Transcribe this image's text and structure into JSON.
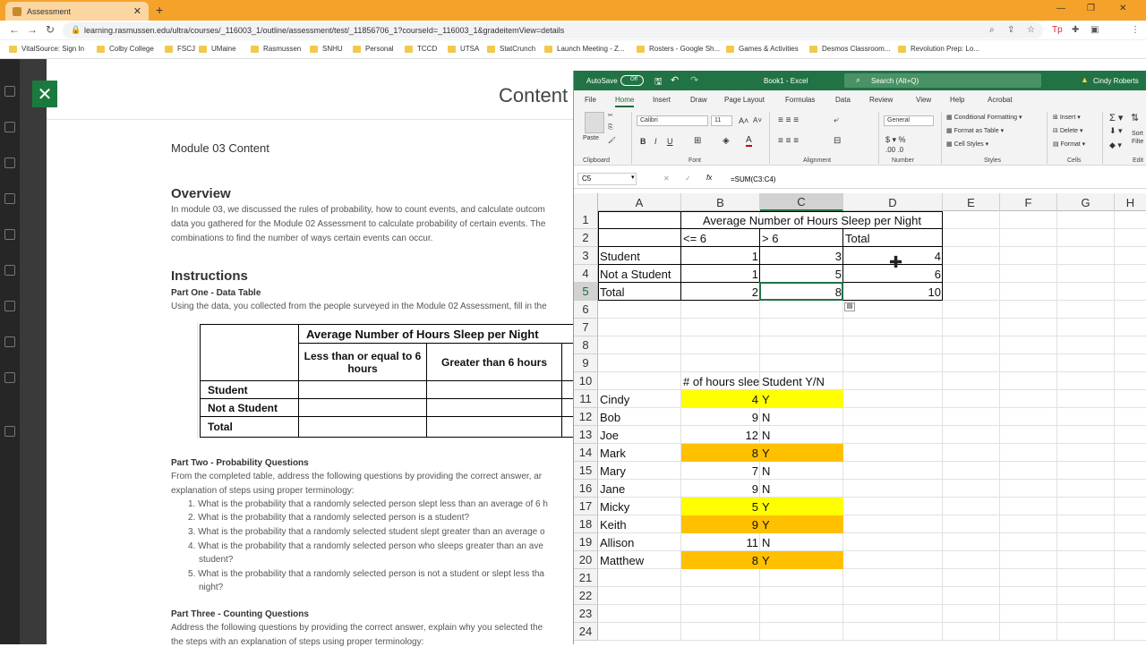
{
  "browser": {
    "tab_title": "Assessment",
    "url": "learning.rasmussen.edu/ultra/courses/_116003_1/outline/assessment/test/_11856706_1?courseId=_116003_1&gradeitemView=details",
    "bookmarks": [
      "VitalSource: Sign In",
      "Colby College",
      "FSCJ",
      "UMaine",
      "Rasmussen",
      "SNHU",
      "Personal",
      "TCCD",
      "UTSA",
      "StatCrunch",
      "Launch Meeting - Z...",
      "Rosters - Google Sh...",
      "Games & Activities",
      "Desmos Classroom...",
      "Revolution Prep: Lo..."
    ]
  },
  "lms": {
    "header_title": "Content",
    "module_title": "Module 03 Content",
    "overview_heading": "Overview",
    "overview_lines": [
      "In module 03, we discussed the rules of probability, how to count events, and calculate outcom",
      "data you gathered for the Module 02 Assessment to calculate probability of certain events. The",
      "combinations to find the number of ways certain events can occur."
    ],
    "instructions_heading": "Instructions",
    "part_one": "Part One - Data Table",
    "part_one_text": "Using the data, you collected from the people surveyed in the Module 02 Assessment, fill in the",
    "table": {
      "header": "Average Number of Hours Sleep per Night",
      "col1": "Less than or equal to 6 hours",
      "col2": "Greater than 6 hours",
      "rows": [
        "Student",
        "Not a Student",
        "Total"
      ]
    },
    "part_two": "Part Two - Probability Questions",
    "part_two_lines": [
      "From the completed table, address the following questions by providing the correct answer, ar",
      "explanation of steps using proper terminology:"
    ],
    "questions": [
      "1. What is the probability that a randomly selected person slept less than an average of 6 h",
      "2. What is the probability that a randomly selected person is a student?",
      "3. What is the probability that a randomly selected student slept greater than an average o",
      "4. What is the probability that a randomly selected person who sleeps greater than an ave",
      "student?",
      "5. What is the probability that a randomly selected person is not a student or slept less tha",
      "night?"
    ],
    "part_three": "Part Three - Counting Questions",
    "part_three_lines": [
      "Address the following questions by providing the correct answer, explain why you selected the",
      "the steps with an explanation of steps using proper terminology:"
    ]
  },
  "excel": {
    "autosave": "AutoSave",
    "toggle": "Off",
    "book": "Book1 - Excel",
    "search": "Search (Alt+Q)",
    "user": "Cindy Roberts",
    "tabs": [
      "File",
      "Home",
      "Insert",
      "Draw",
      "Page Layout",
      "Formulas",
      "Data",
      "Review",
      "View",
      "Help",
      "Acrobat"
    ],
    "ribbon": {
      "paste": "Paste",
      "clipboard": "Clipboard",
      "font": "Font",
      "font_name": "Calibri",
      "font_size": "11",
      "alignment": "Alignment",
      "number_format": "General",
      "number": "Number",
      "cond_format": "Conditional Formatting",
      "format_table": "Format as Table",
      "cell_styles": "Cell Styles",
      "styles": "Styles",
      "insert": "Insert",
      "delete": "Delete",
      "format": "Format",
      "cells": "Cells",
      "sort": "Sort",
      "filter": "Filte",
      "edit": "Edit"
    },
    "namebox": "C5",
    "formula": "=SUM(C3:C4)",
    "columns": [
      "A",
      "B",
      "C",
      "D",
      "E",
      "F",
      "G",
      "H"
    ],
    "rows": [
      "1",
      "2",
      "3",
      "4",
      "5",
      "6",
      "7",
      "8",
      "9",
      "10",
      "11",
      "12",
      "13",
      "14",
      "15",
      "16",
      "17",
      "18",
      "19",
      "20",
      "21",
      "22",
      "23",
      "24"
    ],
    "table": {
      "title": "Average Number of Hours Sleep per Night",
      "headers": [
        "<= 6",
        "> 6",
        "Total"
      ],
      "data": [
        [
          "Student",
          "1",
          "3",
          "4"
        ],
        [
          "Not a Student",
          "1",
          "5",
          "6"
        ],
        [
          "Total",
          "2",
          "8",
          "10"
        ]
      ]
    },
    "list_headers": [
      "# of hours sleep",
      "Student Y/N"
    ],
    "list": [
      {
        "name": "Cindy",
        "hours": "4",
        "student": "Y",
        "color": "#ffff00"
      },
      {
        "name": "Bob",
        "hours": "9",
        "student": "N",
        "color": ""
      },
      {
        "name": "Joe",
        "hours": "12",
        "student": "N",
        "color": ""
      },
      {
        "name": "Mark",
        "hours": "8",
        "student": "Y",
        "color": "#ffc000"
      },
      {
        "name": "Mary",
        "hours": "7",
        "student": "N",
        "color": ""
      },
      {
        "name": "Jane",
        "hours": "9",
        "student": "N",
        "color": ""
      },
      {
        "name": "Micky",
        "hours": "5",
        "student": "Y",
        "color": "#ffff00"
      },
      {
        "name": "Keith",
        "hours": "9",
        "student": "Y",
        "color": "#ffc000"
      },
      {
        "name": "Allison",
        "hours": "11",
        "student": "N",
        "color": ""
      },
      {
        "name": "Matthew",
        "hours": "8",
        "student": "Y",
        "color": "#ffc000"
      }
    ]
  }
}
